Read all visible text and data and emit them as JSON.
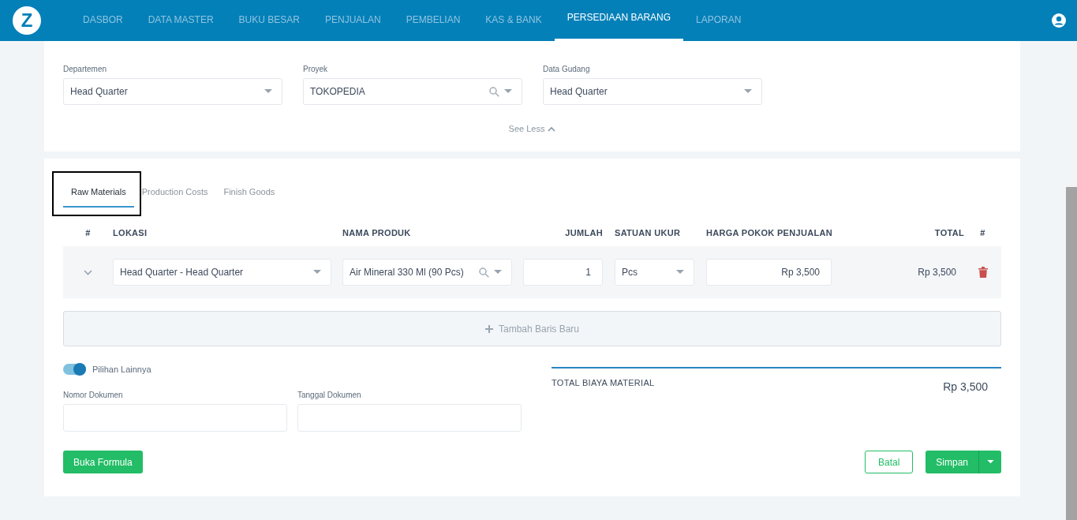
{
  "nav": {
    "logo": "Z",
    "items": [
      {
        "label": "DASBOR",
        "selected": false
      },
      {
        "label": "DATA MASTER",
        "selected": false
      },
      {
        "label": "BUKU BESAR",
        "selected": false
      },
      {
        "label": "PENJUALAN",
        "selected": false
      },
      {
        "label": "PEMBELIAN",
        "selected": false
      },
      {
        "label": "KAS & BANK",
        "selected": false
      },
      {
        "label": "PERSEDIAAN BARANG",
        "selected": true
      },
      {
        "label": "LAPORAN",
        "selected": false
      }
    ]
  },
  "filters": [
    {
      "label": "Departemen",
      "value": "Head Quarter",
      "kind": "select"
    },
    {
      "label": "Proyek",
      "value": "TOKOPEDIA",
      "kind": "search"
    },
    {
      "label": "Data Gudang",
      "value": "Head Quarter",
      "kind": "select"
    }
  ],
  "see_less": "See Less",
  "tabs": [
    {
      "label": "Raw Materials",
      "selected": true,
      "outlined": true
    },
    {
      "label": "Production Costs",
      "selected": false,
      "outlined": false
    },
    {
      "label": "Finish Goods",
      "selected": false,
      "outlined": false
    }
  ],
  "table": {
    "columns": [
      "#",
      "LOKASI",
      "NAMA PRODUK",
      "JUMLAH",
      "SATUAN UKUR",
      "HARGA POKOK PENJUALAN",
      "TOTAL",
      "#"
    ],
    "rows": [
      {
        "lokasi": "Head Quarter - Head Quarter",
        "produk": "Air Mineral 330 Ml (90 Pcs)",
        "jumlah": "1",
        "satuan": "Pcs",
        "harga": "Rp 3,500",
        "total": "Rp 3,500"
      }
    ]
  },
  "add_row": "Tambah Baris Baru",
  "other_options": {
    "label": "Pilihan Lainnya",
    "on": true
  },
  "doc_fields": [
    {
      "label": "Nomor Dokumen"
    },
    {
      "label": "Tanggal Dokumen"
    }
  ],
  "summary": {
    "label": "TOTAL BIAYA MATERIAL",
    "value": "Rp 3,500"
  },
  "buttons": {
    "formula": "Buka Formula",
    "cancel": "Batal",
    "save": "Simpan"
  }
}
